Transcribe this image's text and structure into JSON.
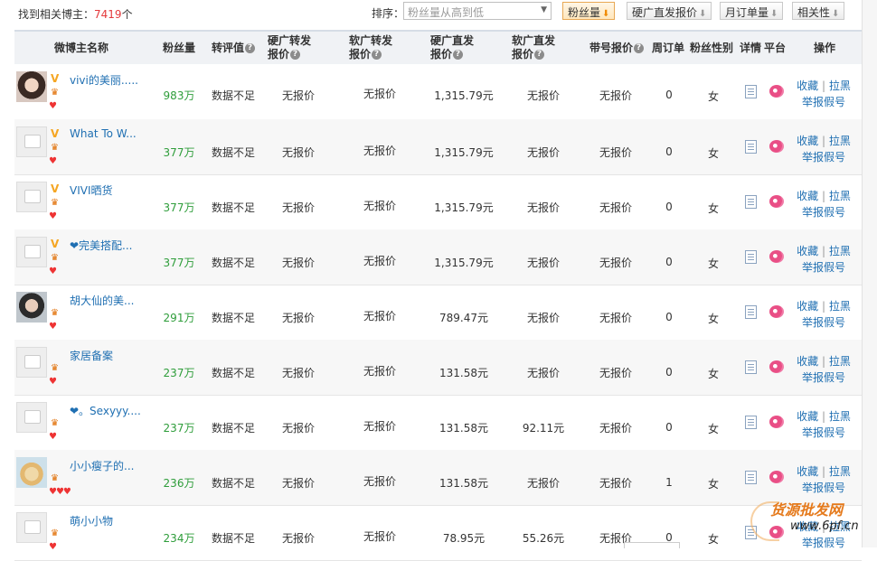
{
  "topbar": {
    "found_prefix": "找到相关博主：",
    "found_count": "7419",
    "found_suffix": "个",
    "sort_label": "排序：",
    "sort_select_value": "粉丝量从高到低",
    "sort_buttons": [
      {
        "label": "粉丝量",
        "arrow": "⬇",
        "active": true
      },
      {
        "label": "硬广直发报价",
        "arrow": "⬇"
      },
      {
        "label": "月订单量",
        "arrow": "⬇"
      },
      {
        "label": "相关性",
        "arrow": "⬇"
      }
    ]
  },
  "headers": {
    "name": "微博主名称",
    "fans": "粉丝量",
    "rating": "转评值",
    "hard_fwd_1": "硬广转发",
    "hard_fwd_2": "报价",
    "soft_fwd_1": "软广转发",
    "soft_fwd_2": "报价",
    "hard_direct_1": "硬广直发",
    "hard_direct_2": "报价",
    "soft_direct_1": "软广直发",
    "soft_direct_2": "报价",
    "tag_price": "带号报价",
    "weekly": "周订单",
    "gender": "粉丝性别",
    "detail": "详情",
    "platform": "平台",
    "ops": "操作",
    "q": "?"
  },
  "common": {
    "collect": "收藏",
    "sep": "|",
    "block": "拉黑",
    "report": "举报假号",
    "vbadge": "V",
    "lvl": "♛",
    "heart": "♥"
  },
  "rows": [
    {
      "name": "vivi的美丽.....",
      "avatar": "p1",
      "v": true,
      "hearts": "♥",
      "fans": "983万",
      "rating": "数据不足",
      "hard_fwd": "无报价",
      "soft_fwd": "无报价",
      "hard_direct": "1,315.79元",
      "soft_direct": "无报价",
      "tag_price": "无报价",
      "weekly": "0",
      "gender": "女"
    },
    {
      "name": "What To W...",
      "avatar": "def",
      "v": true,
      "hearts": "♥",
      "fans": "377万",
      "rating": "数据不足",
      "hard_fwd": "无报价",
      "soft_fwd": "无报价",
      "hard_direct": "1,315.79元",
      "soft_direct": "无报价",
      "tag_price": "无报价",
      "weekly": "0",
      "gender": "女"
    },
    {
      "name": "VIVI晒货",
      "avatar": "def",
      "v": true,
      "hearts": "♥",
      "fans": "377万",
      "rating": "数据不足",
      "hard_fwd": "无报价",
      "soft_fwd": "无报价",
      "hard_direct": "1,315.79元",
      "soft_direct": "无报价",
      "tag_price": "无报价",
      "weekly": "0",
      "gender": "女"
    },
    {
      "name": "❤完美搭配...",
      "avatar": "def",
      "v": true,
      "hearts": "♥",
      "fans": "377万",
      "rating": "数据不足",
      "hard_fwd": "无报价",
      "soft_fwd": "无报价",
      "hard_direct": "1,315.79元",
      "soft_direct": "无报价",
      "tag_price": "无报价",
      "weekly": "0",
      "gender": "女"
    },
    {
      "name": "胡大仙的美...",
      "avatar": "p2",
      "v": false,
      "hearts": "♥",
      "fans": "291万",
      "rating": "数据不足",
      "hard_fwd": "无报价",
      "soft_fwd": "无报价",
      "hard_direct": "789.47元",
      "soft_direct": "无报价",
      "tag_price": "无报价",
      "weekly": "0",
      "gender": "女"
    },
    {
      "name": "家居备案",
      "avatar": "def",
      "v": false,
      "hearts": "♥",
      "fans": "237万",
      "rating": "数据不足",
      "hard_fwd": "无报价",
      "soft_fwd": "无报价",
      "hard_direct": "131.58元",
      "soft_direct": "无报价",
      "tag_price": "无报价",
      "weekly": "0",
      "gender": "女"
    },
    {
      "name": "❤。Sexyyy....",
      "avatar": "def",
      "v": false,
      "hearts": "♥",
      "fans": "237万",
      "rating": "数据不足",
      "hard_fwd": "无报价",
      "soft_fwd": "无报价",
      "hard_direct": "131.58元",
      "soft_direct": "92.11元",
      "tag_price": "无报价",
      "weekly": "0",
      "gender": "女"
    },
    {
      "name": "小小瘦子的...",
      "avatar": "p3",
      "v": false,
      "hearts": "♥♥♥",
      "fans": "236万",
      "rating": "数据不足",
      "hard_fwd": "无报价",
      "soft_fwd": "无报价",
      "hard_direct": "131.58元",
      "soft_direct": "无报价",
      "tag_price": "无报价",
      "weekly": "1",
      "gender": "女"
    },
    {
      "name": "萌小小物",
      "avatar": "def",
      "v": false,
      "hearts": "♥",
      "fans": "234万",
      "rating": "数据不足",
      "hard_fwd": "无报价",
      "soft_fwd": "无报价",
      "hard_direct": "78.95元",
      "soft_direct": "55.26元",
      "tag_price": "无报价",
      "weekly": "0",
      "gender": "女"
    }
  ],
  "watermark": {
    "line1": "货源批发网",
    "line2": "www.6pf.cn"
  }
}
